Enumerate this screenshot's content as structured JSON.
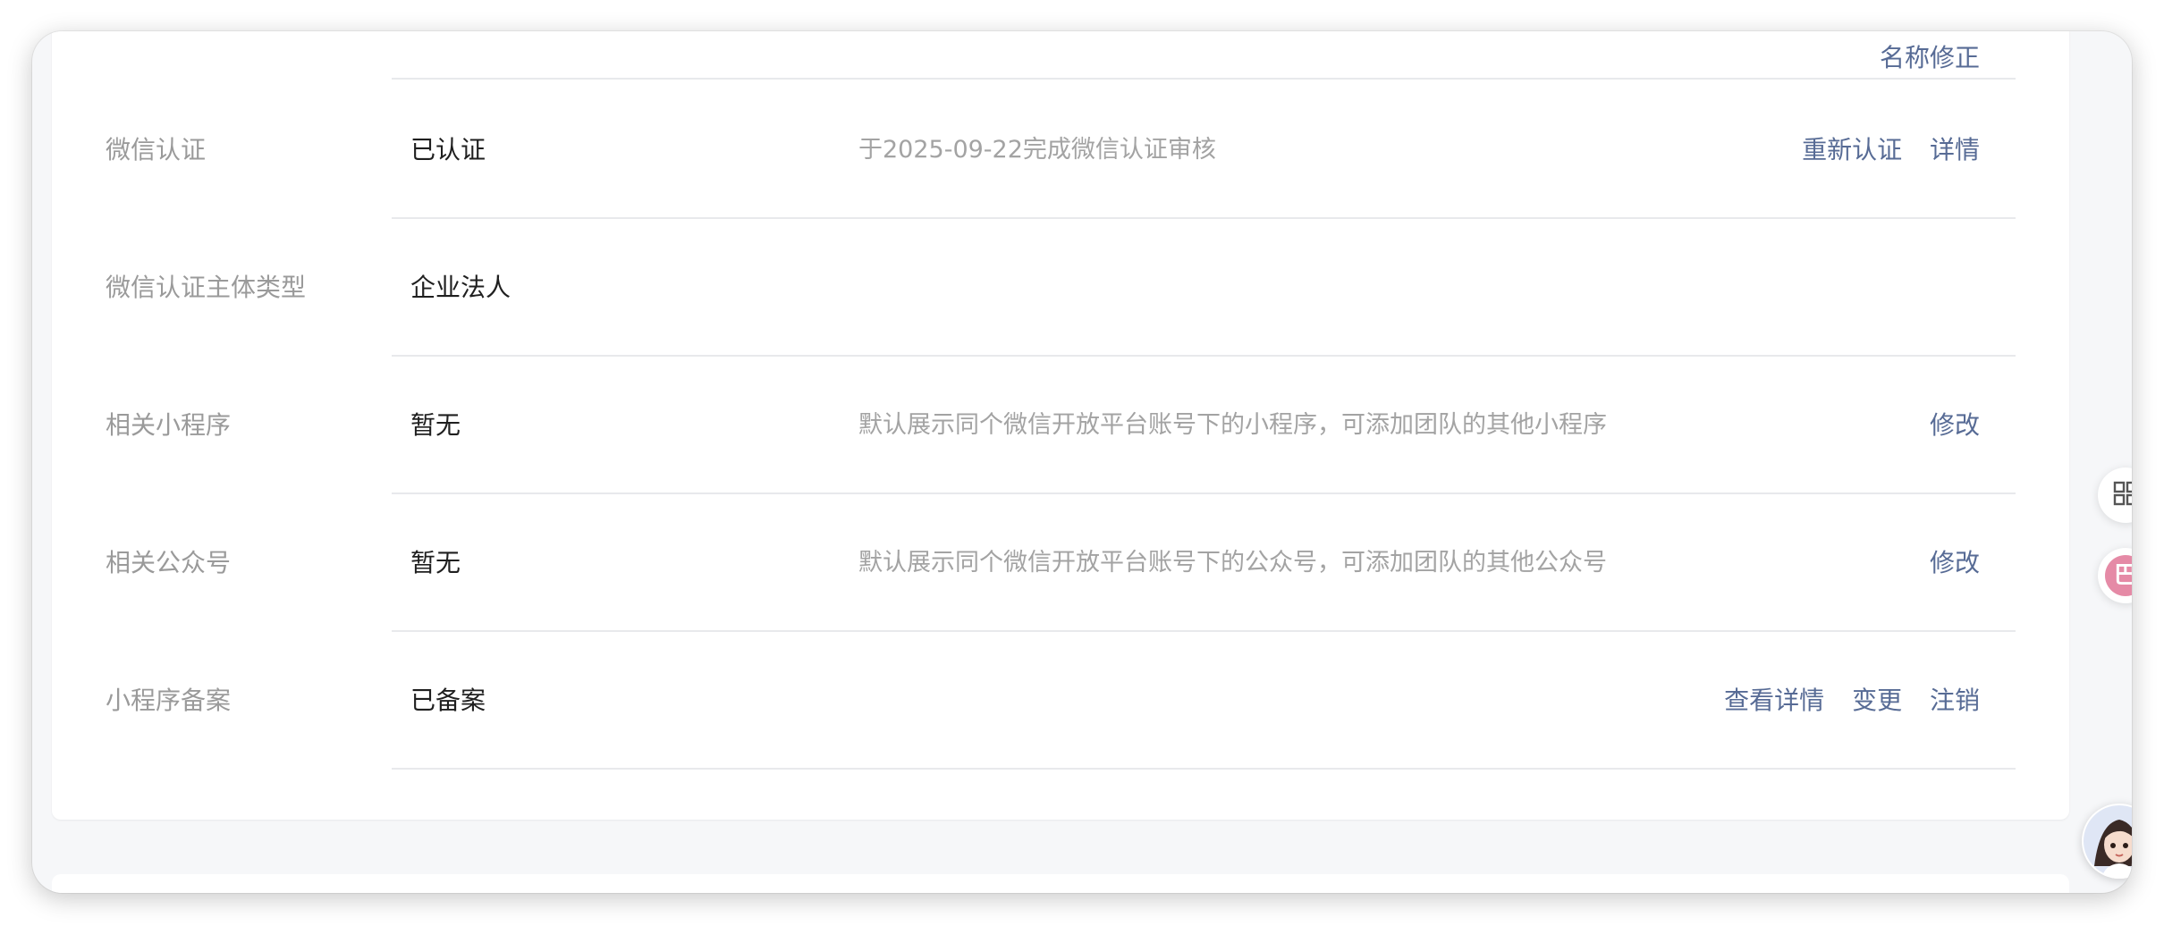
{
  "top_row": {
    "action": "名称修正"
  },
  "rows": [
    {
      "label": "微信认证",
      "value": "已认证",
      "desc": "于2025-09-22完成微信认证审核",
      "actions": [
        "重新认证",
        "详情"
      ]
    },
    {
      "label": "微信认证主体类型",
      "value": "企业法人",
      "desc": "",
      "actions": []
    },
    {
      "label": "相关小程序",
      "value": "暂无",
      "desc": "默认展示同个微信开放平台账号下的小程序，可添加团队的其他小程序",
      "actions": [
        "修改"
      ]
    },
    {
      "label": "相关公众号",
      "value": "暂无",
      "desc": "默认展示同个微信开放平台账号下的公众号，可添加团队的其他公众号",
      "actions": [
        "修改"
      ]
    },
    {
      "label": "小程序备案",
      "value": "已备案",
      "desc": "",
      "actions": [
        "查看详情",
        "变更",
        "注销"
      ]
    }
  ],
  "floating": {
    "grid_icon": "grid-icon",
    "chat_icon": "chat-icon",
    "chat_glyph": "巴",
    "avatar_icon": "assistant-avatar-icon"
  },
  "colors": {
    "link": "#576b95",
    "label": "#9a9a9a",
    "value": "#1f1f1f",
    "desc": "#a3a3a3",
    "divider": "#e8e9ec",
    "chat_badge": "#e58aa6"
  }
}
